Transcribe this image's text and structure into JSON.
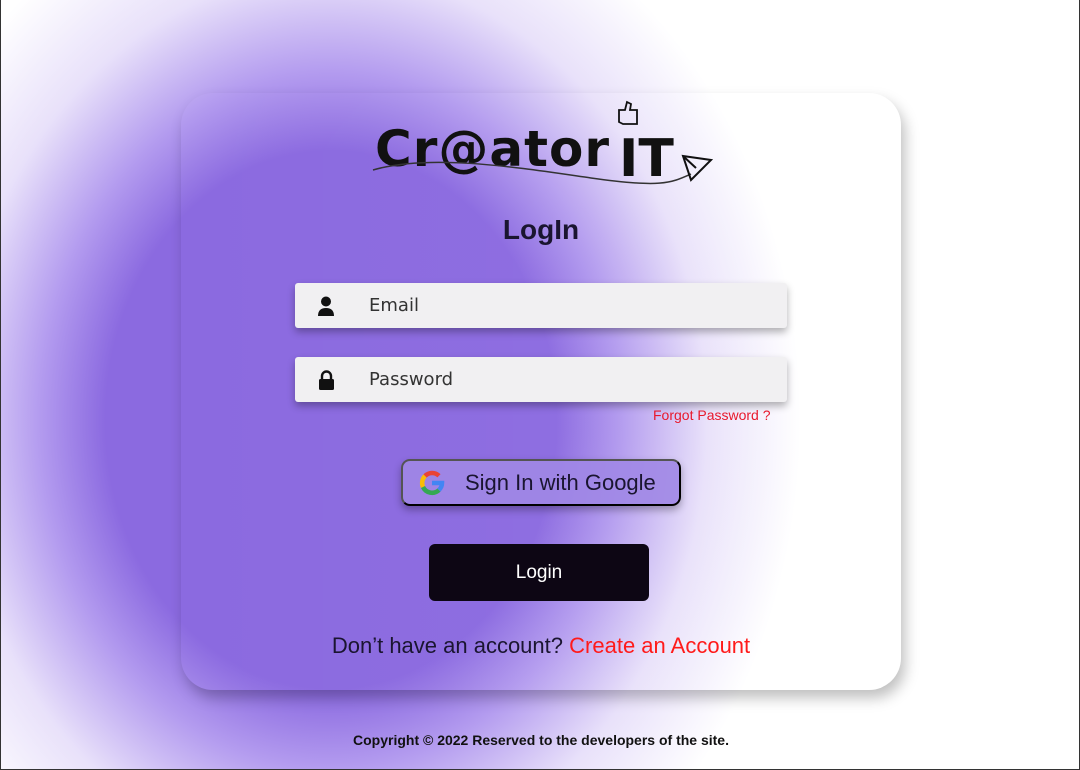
{
  "logo": {
    "text": "Creator IT"
  },
  "title": "LogIn",
  "email": {
    "placeholder": "Email",
    "icon": "user-icon"
  },
  "password": {
    "placeholder": "Password",
    "icon": "lock-icon"
  },
  "forgot_password": "Forgot Password ?",
  "google_button": {
    "label": "Sign In with Google",
    "icon": "google-icon"
  },
  "login_button": "Login",
  "signup": {
    "prompt": "Don’t have an account?",
    "link": "Create an Account"
  },
  "footer": {
    "copyright": "Copyright © 2022 Reserved to the developers of the site."
  },
  "colors": {
    "accent": "#8b6ae0",
    "link": "#ff1a1a",
    "button": "#0d0614"
  }
}
